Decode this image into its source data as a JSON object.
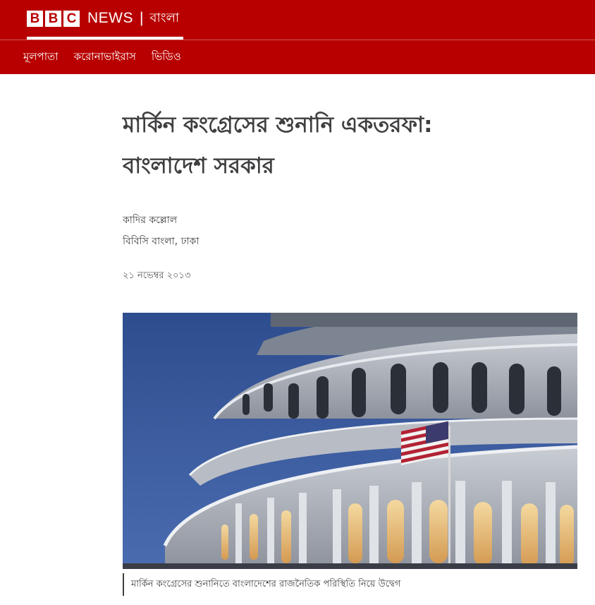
{
  "header": {
    "brand_letters": [
      "B",
      "B",
      "C"
    ],
    "brand_news": "NEWS",
    "brand_separator": "|",
    "brand_language": "বাংলা",
    "color": "#b80000"
  },
  "nav": {
    "items": [
      {
        "label": "মূলপাতা"
      },
      {
        "label": "করোনাভাইরাস"
      },
      {
        "label": "ভিডিও"
      }
    ]
  },
  "article": {
    "title_line1": "মার্কিন কংগ্রেসের শুনানি একতরফা:",
    "title_line2": "বাংলাদেশ সরকার",
    "author": "কাদির কল্লোল",
    "author_role": "বিবিসি বাংলা, ঢাকা",
    "date": "২১ নভেম্বর ২০১৩"
  },
  "figure": {
    "image": "us-capitol-dome-with-american-flag",
    "caption": "মার্কিন কংগ্রেসের শুনানিতে বাংলাদেশের রাজনৈতিক পরিস্থিতি নিয়ে উদ্বেগ"
  }
}
